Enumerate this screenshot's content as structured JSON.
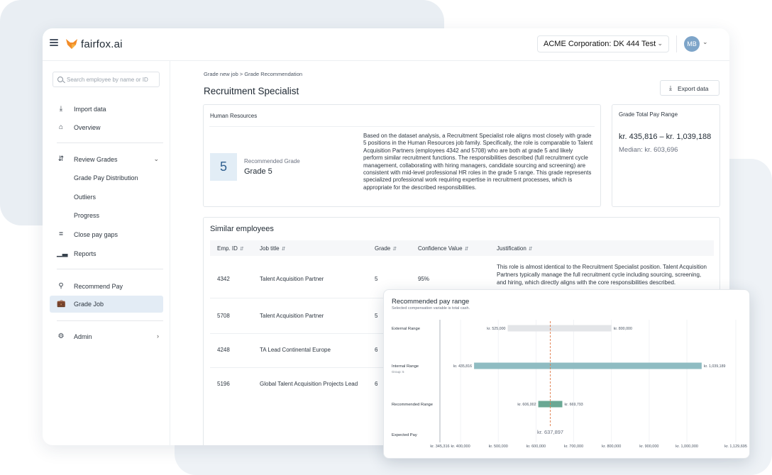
{
  "app": {
    "brand": "fairfox.ai",
    "company": "ACME Corporation: DK 444 Test",
    "user_initials": "MB"
  },
  "sidebar": {
    "search_placeholder": "Search employee by name or ID",
    "items": [
      {
        "label": "Import data",
        "icon": "download-icon"
      },
      {
        "label": "Overview",
        "icon": "home-icon"
      },
      {
        "label": "Review Grades",
        "icon": "sliders-icon"
      },
      {
        "label": "Grade Pay Distribution"
      },
      {
        "label": "Outliers"
      },
      {
        "label": "Progress"
      },
      {
        "label": "Close pay gaps",
        "icon": "equals-icon"
      },
      {
        "label": "Reports",
        "icon": "bar-chart-icon"
      },
      {
        "label": "Recommend Pay",
        "icon": "search-money-icon"
      },
      {
        "label": "Grade Job",
        "icon": "briefcase-icon"
      },
      {
        "label": "Admin",
        "icon": "gear-icon"
      }
    ]
  },
  "main": {
    "breadcrumb": "Grade new job  >  Grade Recommendation",
    "title": "Recruitment Specialist",
    "export_label": "Export data",
    "job_family": "Human Resources",
    "grade_number": "5",
    "recommended_label": "Recommended Grade",
    "recommended_value": "Grade 5",
    "description": "Based on the dataset analysis, a Recruitment Specialist role aligns most closely with grade 5 positions in the Human Resources job family. Specifically, the role is comparable to Talent Acquisition Partners (employees 4342 and 5708) who are both at grade 5 and likely perform similar recruitment functions. The responsibilities described (full recruitment cycle management, collaborating with hiring managers, candidate sourcing and screening) are consistent with mid-level professional HR roles in the grade 5 range. This grade represents specialized professional work requiring expertise in recruitment processes, which is appropriate for the described responsibilities.",
    "pay_range_title": "Grade Total Pay Range",
    "pay_range": "kr. 435,816 – kr. 1,039,188",
    "median": "Median: kr. 603,696"
  },
  "similar": {
    "title": "Similar employees",
    "columns": [
      "Emp. ID",
      "Job title",
      "Grade",
      "Confidence Value",
      "Justification"
    ],
    "rows": [
      {
        "id": "4342",
        "title": "Talent Acquisition Partner",
        "grade": "5",
        "confidence": "95%",
        "justification": "This role is almost identical to the Recruitment Specialist position. Talent Acquisition Partners typically manage the full recruitment cycle including sourcing, screening, and hiring, which directly aligns with the core responsibilities described."
      },
      {
        "id": "5708",
        "title": "Talent Acquisition Partner",
        "grade": "5",
        "confidence": "",
        "justification": ""
      },
      {
        "id": "4248",
        "title": "TA Lead Continental Europe",
        "grade": "6",
        "confidence": "",
        "justification": ""
      },
      {
        "id": "5196",
        "title": "Global Talent Acquisition Projects Lead",
        "grade": "6",
        "confidence": "",
        "justification": ""
      }
    ]
  },
  "popup": {
    "title": "Recommended pay range",
    "subtitle": "Selected compensation variable is total cash."
  },
  "chart_data": {
    "type": "bar",
    "title": "Recommended pay range",
    "subtitle": "Selected compensation variable is total cash.",
    "x_ticks": [
      "kr. 345,316",
      "kr. 400,000",
      "kr. 500,000",
      "kr. 600,000",
      "kr. 700,000",
      "kr. 800,000",
      "kr. 900,000",
      "kr. 1,000,000",
      "kr. 1,129,695"
    ],
    "x_tick_values": [
      345316,
      400000,
      500000,
      600000,
      700000,
      800000,
      900000,
      1000000,
      1129695
    ],
    "xlim": [
      345316,
      1129695
    ],
    "categories": [
      "External Range",
      "Internal Range",
      "Recommended Range",
      "Expected Pay"
    ],
    "category_sublabels": [
      "",
      "Group: 5",
      "",
      ""
    ],
    "ranges": [
      {
        "category": "External Range",
        "min": 525000,
        "max": 800000,
        "min_label": "kr. 525,000",
        "max_label": "kr. 800,000",
        "color": "#e3e5e8"
      },
      {
        "category": "Internal Range",
        "min": 435816,
        "max": 1039189,
        "min_label": "kr. 435,816",
        "max_label": "kr. 1,039,189",
        "color": "#8fbcc2"
      },
      {
        "category": "Recommended Range",
        "min": 606002,
        "max": 669793,
        "min_label": "kr. 606,002",
        "max_label": "kr. 669,793",
        "color": "#6aa894"
      }
    ],
    "expected_pay": 637897,
    "expected_pay_label": "kr. 637,897",
    "reference_line_color": "#e07b4a"
  }
}
